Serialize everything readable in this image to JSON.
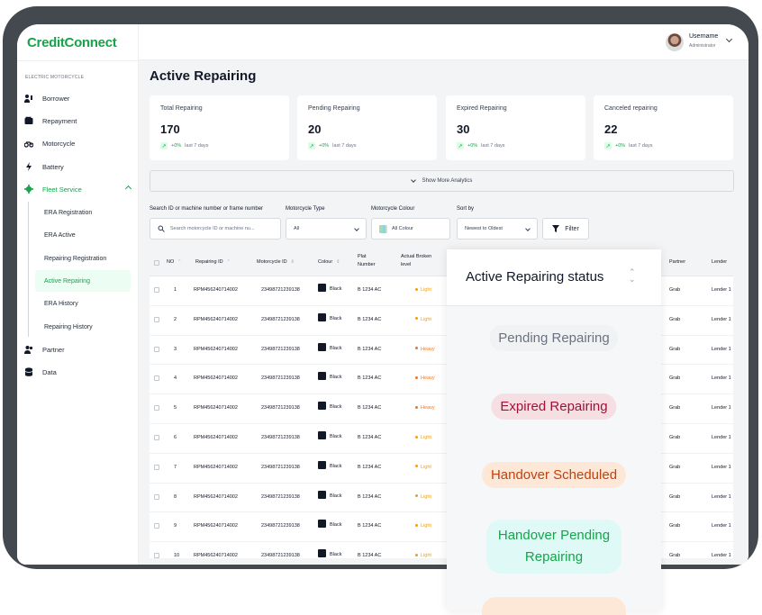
{
  "app": {
    "logo": "CreditConnect"
  },
  "user": {
    "name": "Username",
    "role": "Administrator"
  },
  "sidebar": {
    "section_label": "ELECTRIC MOTORCYCLE",
    "items": [
      {
        "label": "Borrower",
        "icon": "users-key-icon"
      },
      {
        "label": "Repayment",
        "icon": "wallet-icon"
      },
      {
        "label": "Motorcycle",
        "icon": "motorcycle-icon"
      },
      {
        "label": "Battery",
        "icon": "lightning-icon"
      },
      {
        "label": "Fleet Service",
        "icon": "gear-icon"
      }
    ],
    "sub_items": [
      {
        "label": "ERA Registration"
      },
      {
        "label": "ERA Active"
      },
      {
        "label": "Repairing Registration"
      },
      {
        "label": "Active Repairing"
      },
      {
        "label": "ERA History"
      },
      {
        "label": "Repairing History"
      }
    ],
    "bottom_items": [
      {
        "label": "Partner",
        "icon": "partner-icon"
      },
      {
        "label": "Data",
        "icon": "database-icon"
      }
    ]
  },
  "page": {
    "title": "Active Repairing"
  },
  "cards": [
    {
      "label": "Total Repairing",
      "value": "170",
      "pct": "+0%",
      "period": "last 7 days"
    },
    {
      "label": "Pending Repairing",
      "value": "20",
      "pct": "+0%",
      "period": "last 7 days"
    },
    {
      "label": "Expired Repairing",
      "value": "30",
      "pct": "+0%",
      "period": "last 7 days"
    },
    {
      "label": "Canceled repairing",
      "value": "22",
      "pct": "+0%",
      "period": "last 7 days"
    }
  ],
  "analytics_toggle": "Show More Analytics",
  "filters": {
    "search_label": "Search ID or machine number or frame number",
    "search_placeholder": "Search motorcycle ID or machine nu...",
    "type_label": "Motorcycle Type",
    "type_value": "All",
    "colour_label": "Motorcycle Colour",
    "colour_value": "All Colour",
    "sort_label": "Sort by",
    "sort_value": "Newest to Oldest",
    "filter_button": "Filter"
  },
  "table": {
    "headers": {
      "no": "NO",
      "repair_id": "Repairing ID",
      "moto_id": "Motorcycle ID",
      "colour": "Colour",
      "plat": "Plat Number",
      "broken": "Actual Broken level",
      "partner": "Partner",
      "lender": "Lender"
    },
    "rows": [
      {
        "no": "1",
        "repair_id": "RPM456240714002",
        "moto_id": "23498721239138",
        "colour": "Black",
        "plat": "B 1234 AC",
        "level": "Light",
        "partner": "Grab",
        "lender": "Lender 1"
      },
      {
        "no": "2",
        "repair_id": "RPM456240714002",
        "moto_id": "23498721239138",
        "colour": "Black",
        "plat": "B 1234 AC",
        "level": "Light",
        "partner": "Grab",
        "lender": "Lender 1"
      },
      {
        "no": "3",
        "repair_id": "RPM456240714002",
        "moto_id": "23498721239138",
        "colour": "Black",
        "plat": "B 1234 AC",
        "level": "Heavy",
        "partner": "Grab",
        "lender": "Lender 1"
      },
      {
        "no": "4",
        "repair_id": "RPM456240714002",
        "moto_id": "23498721239138",
        "colour": "Black",
        "plat": "B 1234 AC",
        "level": "Heavy",
        "partner": "Grab",
        "lender": "Lender 1"
      },
      {
        "no": "5",
        "repair_id": "RPM456240714002",
        "moto_id": "23498721239138",
        "colour": "Black",
        "plat": "B 1234 AC",
        "level": "Heavy",
        "partner": "Grab",
        "lender": "Lender 1"
      },
      {
        "no": "6",
        "repair_id": "RPM456240714002",
        "moto_id": "23498721239138",
        "colour": "Black",
        "plat": "B 1234 AC",
        "level": "Light",
        "partner": "Grab",
        "lender": "Lender 1"
      },
      {
        "no": "7",
        "repair_id": "RPM456240714002",
        "moto_id": "23498721239138",
        "colour": "Black",
        "plat": "B 1234 AC",
        "level": "Light",
        "partner": "Grab",
        "lender": "Lender 1"
      },
      {
        "no": "8",
        "repair_id": "RPM456240714002",
        "moto_id": "23498721239138",
        "colour": "Black",
        "plat": "B 1234 AC",
        "level": "Light",
        "partner": "Grab",
        "lender": "Lender 1"
      },
      {
        "no": "9",
        "repair_id": "RPM456240714002",
        "moto_id": "23498721239138",
        "colour": "Black",
        "plat": "B 1234 AC",
        "level": "Light",
        "partner": "Grab",
        "lender": "Lender 1"
      },
      {
        "no": "10",
        "repair_id": "RPM456240714002",
        "moto_id": "23498721239138",
        "colour": "Black",
        "plat": "B 1234 AC",
        "level": "Light",
        "partner": "Grab",
        "lender": "Lender 1"
      }
    ]
  },
  "status_dropdown": {
    "title": "Active Repairing status",
    "options": [
      {
        "label": "Pending Repairing",
        "bg": "#f1f2f4",
        "fg": "#6b7280"
      },
      {
        "label": "Expired Repairing",
        "bg": "#f6dfe3",
        "fg": "#9f1239"
      },
      {
        "label": "Handover Scheduled",
        "bg": "#fde8d7",
        "fg": "#c2410c"
      },
      {
        "label": "Handover Pending Repairing",
        "bg": "#dffaf6",
        "fg": "#16a34a"
      }
    ]
  },
  "colors": {
    "brand": "#16a34a",
    "light": "#f59e0b",
    "heavy": "#f97316"
  }
}
